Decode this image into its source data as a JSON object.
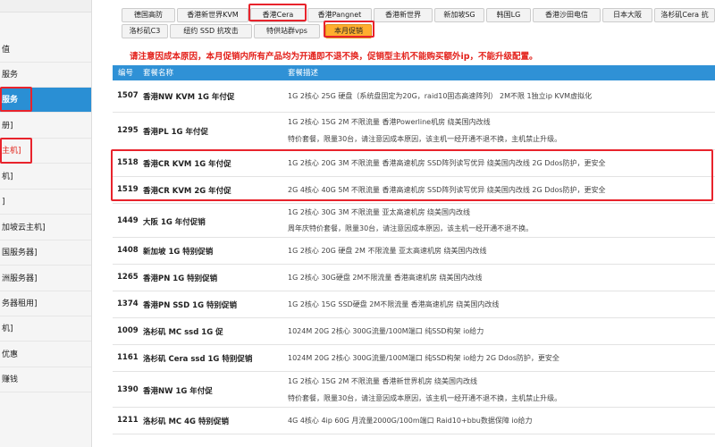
{
  "sidebar": {
    "items": [
      {
        "label": "值"
      },
      {
        "label": "服务"
      },
      {
        "label": "服务"
      },
      {
        "label": "册]"
      },
      {
        "label": "主机]"
      },
      {
        "label": "机]"
      },
      {
        "label": "]"
      },
      {
        "label": "加坡云主机]"
      },
      {
        "label": "国服务器]"
      },
      {
        "label": "洲服务器]"
      },
      {
        "label": "务器租用]"
      },
      {
        "label": "机]"
      },
      {
        "label": "优惠"
      },
      {
        "label": "赚钱"
      }
    ]
  },
  "tabs": [
    {
      "label": "德国高防"
    },
    {
      "label": "香港新世界KVM"
    },
    {
      "label": "香港Cera"
    },
    {
      "label": "香港Pangnet"
    },
    {
      "label": "香港新世界"
    },
    {
      "label": "新加坡SG"
    },
    {
      "label": "韩国LG"
    },
    {
      "label": "香港沙田电信"
    },
    {
      "label": "日本大阪"
    },
    {
      "label": "洛杉矶Cera 抗"
    },
    {
      "label": "洛杉矶C3"
    },
    {
      "label": "纽约 SSD 抗攻击"
    },
    {
      "label": "特供站群vps"
    },
    {
      "label": "本月促销"
    }
  ],
  "notice": "请注意因成本原因，本月促销内所有产品均为开通即不退不换，促销型主机不能购买额外ip，不能升级配置。",
  "table": {
    "headers": {
      "id": "编号",
      "name": "套餐名称",
      "desc": "套餐描述"
    },
    "rows": [
      {
        "id": "1507",
        "name": "香港NW KVM 1G 年付促",
        "desc": [
          "1G 2核心 25G 硬盘（系统盘固定为20G，raid10固态高速阵列） 2M不限 1独立ip KVM虚拟化"
        ]
      },
      {
        "id": "1295",
        "name": "香港PL 1G 年付促",
        "desc": [
          "1G 2核心 15G 2M 不限流量 香港Powerline机房 绕美国内改线",
          "特价套餐，限量30台，请注意因成本原因，该主机一经开通不退不换，主机禁止升级。"
        ]
      },
      {
        "id": "1518",
        "name": "香港CR KVM 1G 年付促",
        "desc": [
          "1G 2核心 20G 3M 不限流量 香港高速机房 SSD阵列读写优异 绕美国内改线 2G Ddos防护，更安全"
        ]
      },
      {
        "id": "1519",
        "name": "香港CR KVM 2G 年付促",
        "desc": [
          "2G 4核心 40G 5M 不限流量 香港高速机房 SSD阵列读写优异 绕美国内改线 2G Ddos防护，更安全"
        ]
      },
      {
        "id": "1449",
        "name": "大阪 1G 年付促销",
        "desc": [
          "1G 2核心 30G 3M 不限流量 亚太高速机房 绕美国内改线",
          "周年庆特价套餐，限量30台，请注意因成本原因，该主机一经开通不退不换。"
        ]
      },
      {
        "id": "1408",
        "name": "新加坡 1G 特别促销",
        "desc": [
          "1G 2核心 20G 硬盘 2M 不限流量 亚太高速机房 绕美国内改线"
        ]
      },
      {
        "id": "1265",
        "name": "香港PN 1G 特别促销",
        "desc": [
          "1G 2核心 30G硬盘 2M不限流量 香港高速机房 绕美国内改线"
        ]
      },
      {
        "id": "1374",
        "name": "香港PN SSD 1G 特别促销",
        "desc": [
          "1G 2核心 15G SSD硬盘 2M不限流量 香港高速机房 绕美国内改线"
        ]
      },
      {
        "id": "1009",
        "name": "洛杉矶 MC ssd 1G 促",
        "desc": [
          "1024M 20G 2核心 300G流量/100M端口 纯SSD构架 io给力"
        ]
      },
      {
        "id": "1161",
        "name": "洛杉矶 Cera ssd 1G 特别促销",
        "desc": [
          "1024M 20G 2核心 300G流量/100M端口 纯SSD构架 io给力 2G Ddos防护，更安全"
        ]
      },
      {
        "id": "1390",
        "name": "香港NW 1G 年付促",
        "desc": [
          "1G 2核心 15G 2M 不限流量 香港新世界机房 绕美国内改线",
          "特价套餐，限量30台，请注意因成本原因，该主机一经开通不退不换，主机禁止升级。"
        ]
      },
      {
        "id": "1211",
        "name": "洛杉矶 MC 4G 特别促销",
        "desc": [
          "4G 4核心 4ip 60G 月流量2000G/100m端口 Raid10+bbu数据保障 io给力"
        ]
      }
    ]
  },
  "colors": {
    "header_blue": "#2f91d6",
    "active_blue": "#2a8fd4",
    "promo_orange": "#ffae2e",
    "notice_red": "#e3201a",
    "annotation_red": "#e8232c"
  }
}
